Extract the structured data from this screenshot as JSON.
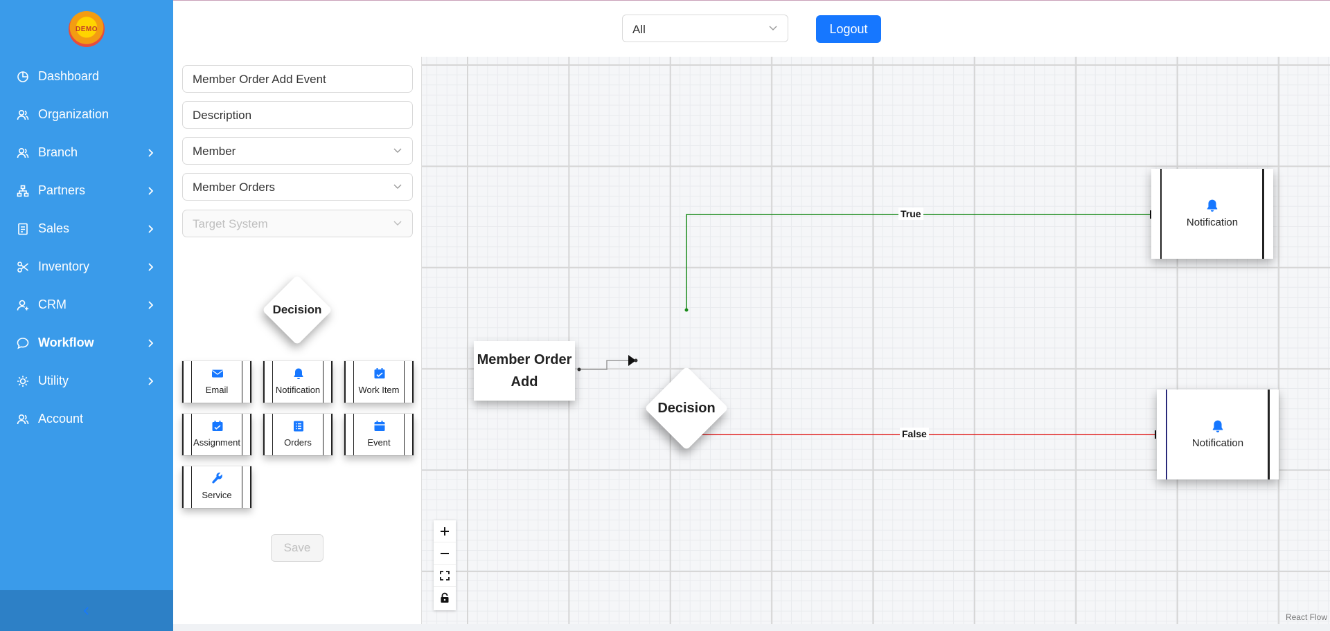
{
  "sidebar": {
    "logo_text": "DEMO",
    "items": [
      {
        "label": "Dashboard",
        "icon": "pie-chart-icon",
        "chevron": false
      },
      {
        "label": "Organization",
        "icon": "team-icon",
        "chevron": false
      },
      {
        "label": "Branch",
        "icon": "team-icon",
        "chevron": true
      },
      {
        "label": "Partners",
        "icon": "cluster-icon",
        "chevron": true
      },
      {
        "label": "Sales",
        "icon": "receipt-icon",
        "chevron": true
      },
      {
        "label": "Inventory",
        "icon": "scissors-icon",
        "chevron": true
      },
      {
        "label": "CRM",
        "icon": "user-icon",
        "chevron": true
      },
      {
        "label": "Workflow",
        "icon": "message-icon",
        "chevron": true,
        "active": true
      },
      {
        "label": "Utility",
        "icon": "sun-icon",
        "chevron": true
      },
      {
        "label": "Account",
        "icon": "team-icon",
        "chevron": false
      }
    ],
    "collapse_icon": "chevron-left-icon"
  },
  "header": {
    "filter_value": "All",
    "logout_label": "Logout"
  },
  "panel": {
    "name_value": "Member Order Add Event",
    "description_value": "Description",
    "entity_value": "Member",
    "event_value": "Member Orders",
    "target_placeholder": "Target System",
    "decision_label": "Decision",
    "tiles": [
      {
        "label": "Email",
        "icon": "mail-icon"
      },
      {
        "label": "Notification",
        "icon": "bell-icon"
      },
      {
        "label": "Work Item",
        "icon": "calendar-check-icon"
      },
      {
        "label": "Assignment",
        "icon": "calendar-check-icon"
      },
      {
        "label": "Orders",
        "icon": "list-icon"
      },
      {
        "label": "Event",
        "icon": "calendar-icon"
      },
      {
        "label": "Service",
        "icon": "wrench-icon"
      }
    ],
    "save_label": "Save"
  },
  "canvas": {
    "start_node_label": "Member Order Add",
    "decision_node_label": "Decision",
    "true_label": "True",
    "false_label": "False",
    "true_color": "#1a8a1a",
    "false_color": "#e02020",
    "notification_true_label": "Notification",
    "notification_false_label": "Notification",
    "controls": [
      "zoom-in-icon",
      "zoom-out-icon",
      "fit-view-icon",
      "lock-icon"
    ],
    "attribution": "React Flow"
  },
  "colors": {
    "sidebar_bg": "#3a9bea",
    "sidebar_footer": "#2d80c6",
    "primary": "#1677ff",
    "icon_blue": "#1677ff"
  }
}
